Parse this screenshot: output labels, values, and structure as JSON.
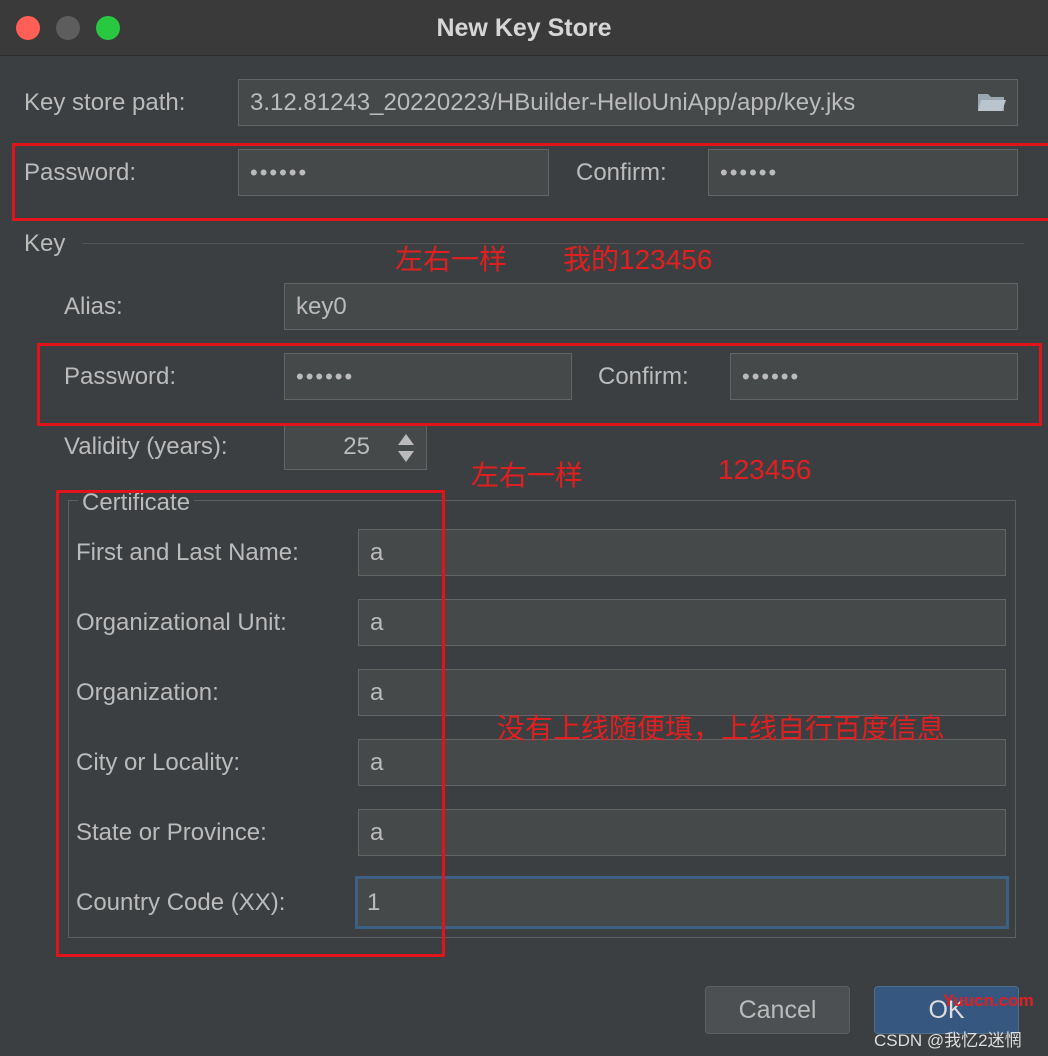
{
  "window": {
    "title": "New Key Store"
  },
  "keystore": {
    "path_label": "Key store path:",
    "path_value": "3.12.81243_20220223/HBuilder-HelloUniApp/app/key.jks",
    "password_label": "Password:",
    "password_value": "••••••",
    "confirm_label": "Confirm:",
    "confirm_value": "••••••"
  },
  "key": {
    "section_label": "Key",
    "alias_label": "Alias:",
    "alias_value": "key0",
    "password_label": "Password:",
    "password_value": "••••••",
    "confirm_label": "Confirm:",
    "confirm_value": "••••••",
    "validity_label": "Validity (years):",
    "validity_value": "25"
  },
  "certificate": {
    "title": "Certificate",
    "name_label": "First and Last Name:",
    "name_value": "a",
    "unit_label": "Organizational Unit:",
    "unit_value": "a",
    "org_label": "Organization:",
    "org_value": "a",
    "city_label": "City or Locality:",
    "city_value": "a",
    "state_label": "State or Province:",
    "state_value": "a",
    "country_label": "Country Code (XX):",
    "country_value": "1"
  },
  "annotations": {
    "same1": "左右一样",
    "mine": "我的123456",
    "same2": "左右一样",
    "pw": "123456",
    "note": "没有上线随便填，上线自行百度信息"
  },
  "buttons": {
    "cancel": "Cancel",
    "ok": "OK"
  },
  "watermarks": {
    "yuucn": "Yuucn.com",
    "csdn": "CSDN @我忆2迷惘"
  },
  "colors": {
    "annotation_red": "#e0141b",
    "ok_button": "#365880"
  }
}
